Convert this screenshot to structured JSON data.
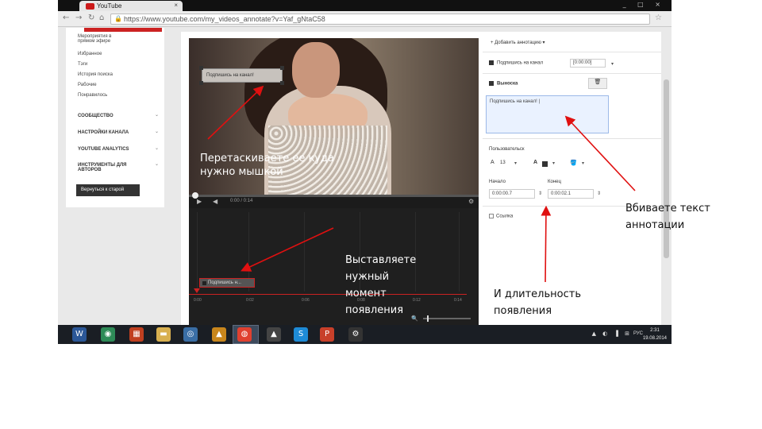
{
  "browser": {
    "tab_title": "YouTube",
    "tab_close": "×",
    "url": "https://www.youtube.com/my_videos_annotate?v=Yaf_gNtaC58",
    "window_controls": "_ □ ×"
  },
  "sidebar": {
    "items": [
      "Мероприятия в прямом эфире",
      "Избранное",
      "Тэги",
      "История поиска",
      "Рабочие",
      "Понравилось"
    ],
    "sections": [
      "СООБЩЕСТВО",
      "НАСТРОЙКИ КАНАЛА",
      "YOUTUBE ANALYTICS",
      "ИНСТРУМЕНТЫ ДЛЯ АВТОРОВ"
    ],
    "old_version_button": "Вернуться к старой"
  },
  "video": {
    "annotation_text": "Подпишись на канал!",
    "overlay_caption": "Перетаскиваете ее куда нужно мышкой",
    "time": "0:00 / 0:14"
  },
  "timeline": {
    "clip_label": "Подпишись н...",
    "labels": [
      "0:00",
      "0:02",
      "0:06",
      "0:08",
      "0:12",
      "0:14"
    ],
    "overlay_caption": "Выставляете нужный момент появления"
  },
  "editor": {
    "add_annotation": "+ Добавить аннотацию ▾",
    "annotation_item": "Подпишись на канал",
    "annotation_time": "[0:00:00]",
    "type_label": "Выноска",
    "textarea_value": "Подпишись на канал! |",
    "style_label": "Пользовательск",
    "font_size": "13",
    "start_label": "Начало",
    "end_label": "Конец",
    "start_value": "0:00:00.7",
    "end_value": "0:00:02.1",
    "link_label": "Ссылка"
  },
  "taskbar": {
    "apps": [
      {
        "icon": "W",
        "color": "#2b5797"
      },
      {
        "icon": "◉",
        "color": "#2e8b57"
      },
      {
        "icon": "▦",
        "color": "#c04020"
      },
      {
        "icon": "▬",
        "color": "#d8b050"
      },
      {
        "icon": "◎",
        "color": "#3a6ea5"
      },
      {
        "icon": "▲",
        "color": "#c8861c"
      },
      {
        "icon": "◍",
        "color": "#e04030"
      },
      {
        "icon": "▲",
        "color": "#444"
      },
      {
        "icon": "S",
        "color": "#1e8bd6"
      },
      {
        "icon": "P",
        "color": "#c8402a"
      },
      {
        "icon": "⚙",
        "color": "#333"
      }
    ],
    "tray_icons": "▲ ◐ ▐ ⊞",
    "lang": "РУС",
    "clock_time": "2:31",
    "clock_date": "19.08.2014"
  },
  "notes": {
    "enter_text": "Вбиваете текст аннотации",
    "duration": "И длительность появления"
  },
  "colors": {
    "arrow": "#e01010",
    "accent": "#cc2222"
  }
}
